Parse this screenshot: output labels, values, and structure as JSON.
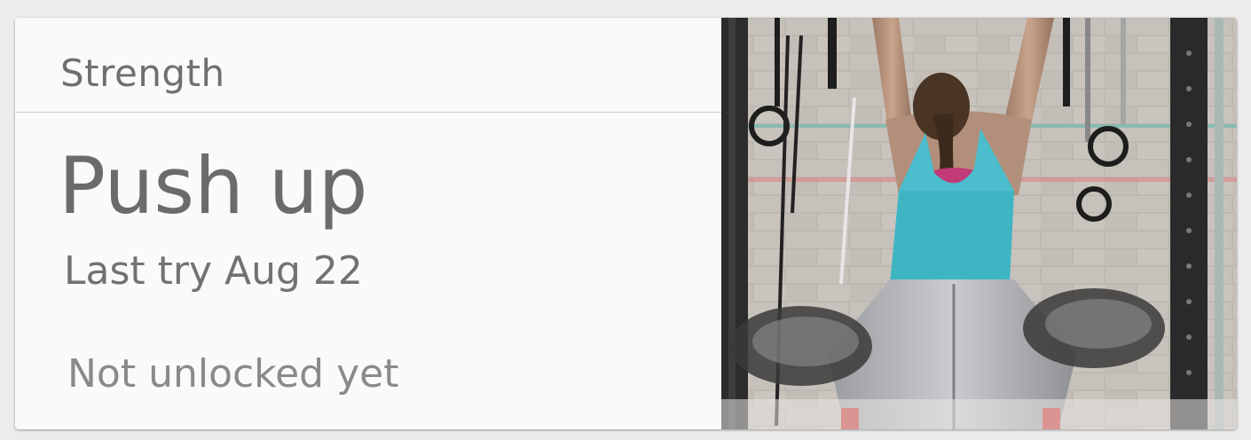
{
  "card": {
    "category": "Strength",
    "exercise_name": "Push up",
    "last_try": "Last try Aug 22",
    "status": "Not unlocked yet"
  },
  "photo": {
    "subject": "athlete-hanging-from-bar"
  },
  "colors": {
    "card_background": "#fafafa",
    "text_primary": "#6b6b6b",
    "text_muted": "#8a8a8a",
    "divider": "#cfcfcf",
    "top_teal": "#3fb5c4",
    "bra_magenta": "#c23a78"
  }
}
